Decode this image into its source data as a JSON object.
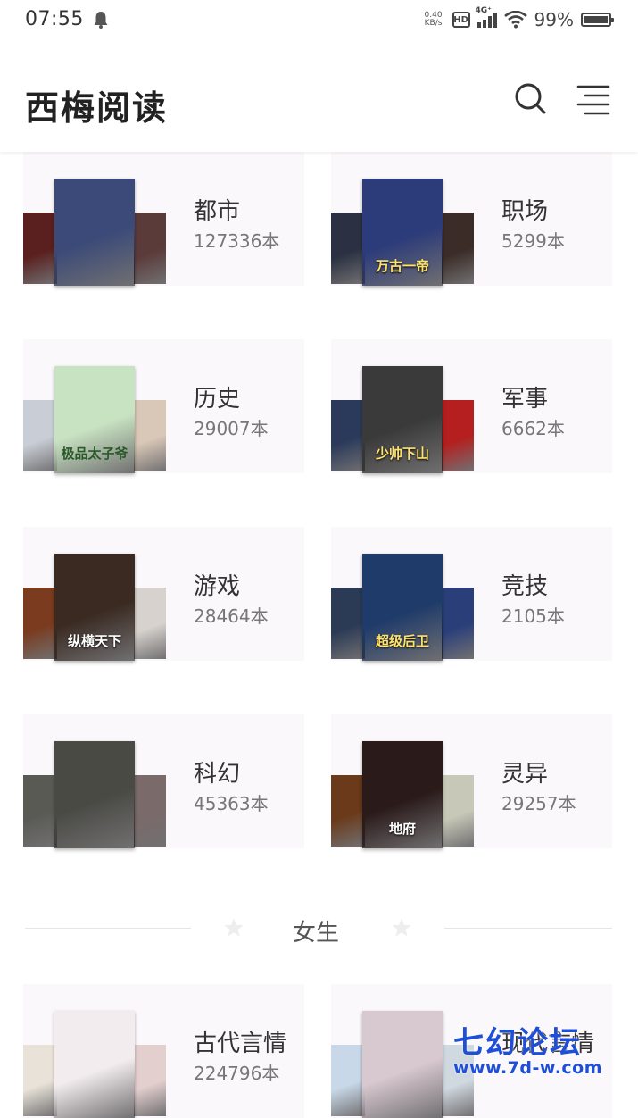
{
  "status_bar": {
    "time": "07:55",
    "speed_top": "0.40",
    "speed_bottom": "KB/s",
    "hd_label": "HD",
    "network_label": "4G⁺",
    "battery_percent": "99%"
  },
  "header": {
    "title": "西梅阅读",
    "icons": [
      "search-icon",
      "menu-list-icon"
    ]
  },
  "categories": [
    {
      "name": "都市",
      "count": "127336本",
      "covers": {
        "left": "#5a1f1f",
        "center": "#3b4a78",
        "right": "#5b3a3a",
        "center_text": ""
      }
    },
    {
      "name": "职场",
      "count": "5299本",
      "covers": {
        "left": "#2b3142",
        "center": "#2c3b7a",
        "right": "#3b2c28",
        "center_text": "万古一帝"
      }
    },
    {
      "name": "历史",
      "count": "29007本",
      "covers": {
        "left": "#c9ced6",
        "center": "#c8e3c2",
        "right": "#d9c7b7",
        "center_text": "极品太子爷"
      }
    },
    {
      "name": "军事",
      "count": "6662本",
      "covers": {
        "left": "#2b3a5a",
        "center": "#3a3a3a",
        "right": "#b51f1f",
        "center_text": "少帅下山"
      }
    },
    {
      "name": "游戏",
      "count": "28464本",
      "covers": {
        "left": "#7a3b1e",
        "center": "#3a2a22",
        "right": "#d7d2cd",
        "center_text": "纵横天下"
      }
    },
    {
      "name": "竞技",
      "count": "2105本",
      "covers": {
        "left": "#2b3a55",
        "center": "#1f3b6a",
        "right": "#2a3f7a",
        "center_text": "超级后卫"
      }
    },
    {
      "name": "科幻",
      "count": "45363本",
      "covers": {
        "left": "#5a5a55",
        "center": "#4a4a45",
        "right": "#7a6a6a",
        "center_text": ""
      }
    },
    {
      "name": "灵异",
      "count": "29257本",
      "covers": {
        "left": "#6a3a1a",
        "center": "#2a1a1a",
        "right": "#c8c8b8",
        "center_text": "地府"
      }
    },
    {
      "name": "古代言情",
      "count": "224796本",
      "covers": {
        "left": "#e8e2d8",
        "center": "#f2ecee",
        "right": "#e4cfcf",
        "center_text": ""
      }
    },
    {
      "name": "现代言情",
      "count": "",
      "covers": {
        "left": "#c8d8e8",
        "center": "#d8c8d0",
        "right": "#d0d8e0",
        "center_text": ""
      }
    }
  ],
  "section_divider": {
    "label": "女生"
  },
  "watermark": {
    "title": "七幻论坛",
    "url": "www.7d-w.com"
  },
  "colors": {
    "card_bg": "#fbf8fb",
    "divider": "#e6e6e6",
    "watermark": "#1e4fd6"
  }
}
